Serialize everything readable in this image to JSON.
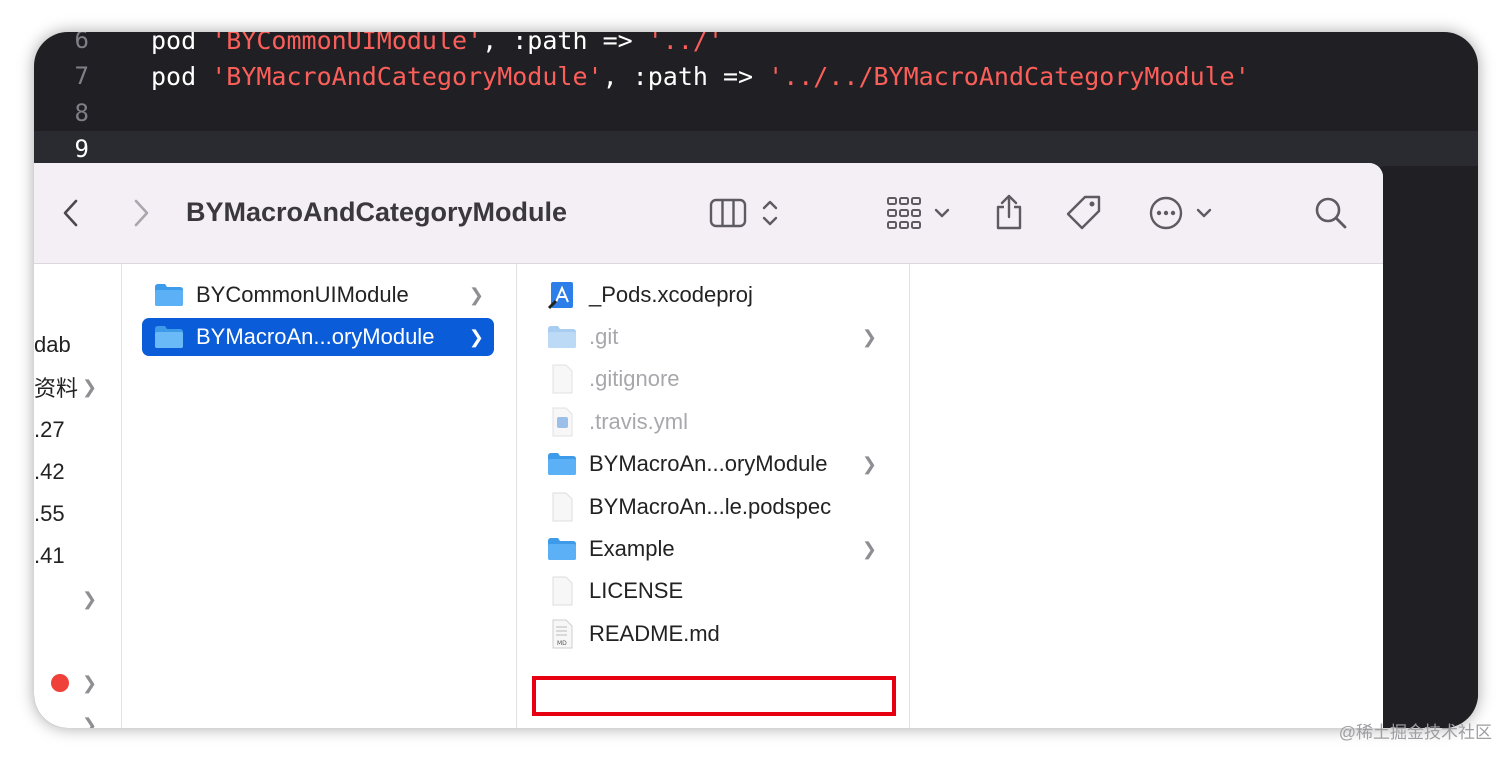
{
  "editor": {
    "lines": [
      {
        "num": "6",
        "kw": "pod ",
        "str": "'BYCommonUIModule'",
        "mid": ", :path => ",
        "str2": "'../'"
      },
      {
        "num": "7",
        "kw": "pod ",
        "str": "'BYMacroAndCategoryModule'",
        "mid": ", :path => ",
        "str2": "'../../BYMacroAndCategoryModule'"
      },
      {
        "num": "8"
      },
      {
        "num": "9"
      }
    ]
  },
  "finder": {
    "title": "BYMacroAndCategoryModule",
    "toolbar_icons": [
      "back-icon",
      "forward-icon",
      "column-view-icon",
      "sort-icon",
      "group-icon",
      "share-icon",
      "tag-icon",
      "more-icon",
      "search-icon"
    ],
    "sidebar_partial": [
      "dab",
      "资料",
      ".27",
      ".42",
      ".55",
      ".41"
    ],
    "column1": [
      {
        "label": "BYCommonUIModule",
        "type": "folder",
        "has_children": true
      },
      {
        "label": "BYMacroAn...oryModule",
        "type": "folder",
        "has_children": true,
        "selected": true
      }
    ],
    "column2": [
      {
        "label": "_Pods.xcodeproj",
        "type": "xcodeproj",
        "has_children": false
      },
      {
        "label": ".git",
        "type": "folder",
        "has_children": true,
        "dim": true
      },
      {
        "label": ".gitignore",
        "type": "file",
        "has_children": false,
        "dim": true
      },
      {
        "label": ".travis.yml",
        "type": "yml",
        "has_children": false,
        "dim": true
      },
      {
        "label": "BYMacroAn...oryModule",
        "type": "folder",
        "has_children": true,
        "highlighted": true
      },
      {
        "label": "BYMacroAn...le.podspec",
        "type": "file",
        "has_children": false
      },
      {
        "label": "Example",
        "type": "folder",
        "has_children": true
      },
      {
        "label": "LICENSE",
        "type": "file",
        "has_children": false
      },
      {
        "label": "README.md",
        "type": "md",
        "has_children": false
      }
    ]
  },
  "colors": {
    "selection": "#0a5cd8",
    "highlight_box": "#e60012",
    "code_string": "#fc5f5a",
    "folder": "#3d9be9"
  },
  "watermark": "@稀土掘金技术社区"
}
